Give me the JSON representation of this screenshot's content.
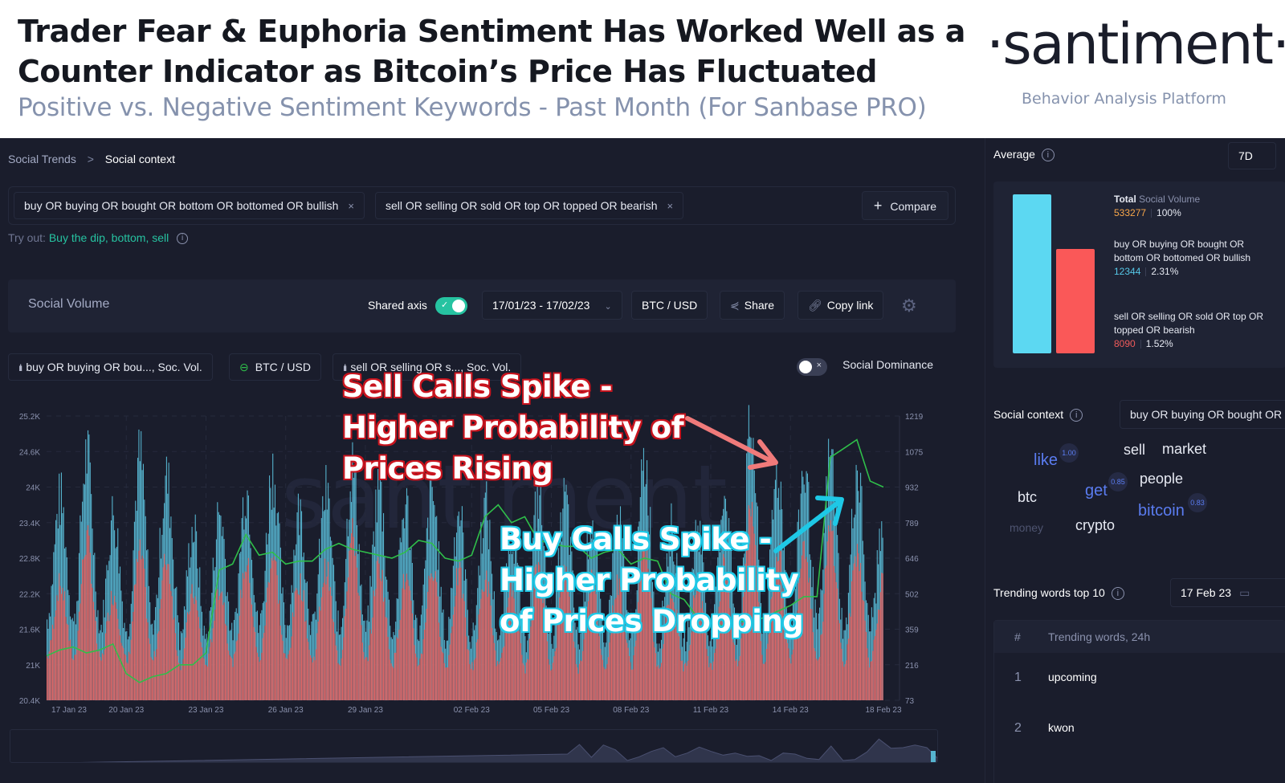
{
  "header": {
    "title_line1": "Trader Fear & Euphoria Sentiment Has Worked Well as a",
    "title_line2": "Counter Indicator as Bitcoin’s Price Has Fluctuated",
    "subtitle": "Positive vs. Negative Sentiment Keywords - Past Month (For Sanbase PRO)",
    "logo": "·santiment·",
    "tagline": "Behavior Analysis Platform"
  },
  "breadcrumb": {
    "parent": "Social Trends",
    "separator": ">",
    "current": "Social context"
  },
  "search": {
    "chips": [
      {
        "label": "buy OR buying OR bought OR bottom OR bottomed OR bullish",
        "remove": "×"
      },
      {
        "label": "sell OR selling OR sold OR top OR topped OR bearish",
        "remove": "×"
      }
    ],
    "compare_icon": "+",
    "compare_label": "Compare"
  },
  "tryout": {
    "prefix": "Try out:",
    "links": "Buy the dip, bottom, sell",
    "info": "i"
  },
  "toolbar": {
    "title": "Social Volume",
    "shared_axis_label": "Shared axis",
    "shared_axis_on": true,
    "date_range": "17/01/23 - 17/02/23",
    "pair": "BTC / USD",
    "share_label": "Share",
    "copy_link_label": "Copy link"
  },
  "legend": {
    "items": [
      {
        "label": "buy OR buying OR bou..., Soc. Vol.",
        "icon": "bars-icon"
      },
      {
        "label": "BTC / USD",
        "icon": "ring-icon"
      },
      {
        "label": "sell OR selling OR s..., Soc. Vol.",
        "icon": "bars-icon"
      }
    ],
    "social_dominance_label": "Social Dominance",
    "social_dominance_on": false
  },
  "annotations": {
    "sell_lines": [
      "Sell Calls Spike -",
      "Higher Probability of",
      "Prices Rising"
    ],
    "buy_lines": [
      "Buy Calls Spike -",
      "Higher Probability",
      "of Prices Dropping"
    ],
    "sell_color": "#f07a7a",
    "buy_color": "#1ec8e6"
  },
  "chart_data": {
    "type": "bar",
    "title": "Social Volume",
    "watermark": "santiment",
    "x_start": "17 Jan 23",
    "x_end": "18 Feb 23",
    "x_tick_labels": [
      "17 Jan 23",
      "20 Jan 23",
      "23 Jan 23",
      "26 Jan 23",
      "29 Jan 23",
      "02 Feb 23",
      "05 Feb 23",
      "08 Feb 23",
      "11 Feb 23",
      "14 Feb 23",
      "18 Feb 23"
    ],
    "left_axis": {
      "label": "BTC / USD",
      "ticks": [
        "20.4K",
        "21K",
        "21.6K",
        "22.2K",
        "22.8K",
        "23.4K",
        "24K",
        "24.6K",
        "25.2K"
      ],
      "range": [
        20400,
        25200
      ]
    },
    "right_axis": {
      "label": "Social Volume",
      "ticks": [
        "73",
        "216",
        "359",
        "502",
        "646",
        "789",
        "932",
        "1075",
        "1219"
      ],
      "range": [
        73,
        1219
      ]
    },
    "series": [
      {
        "name": "buy OR buying OR bought OR bottom OR bottomed OR bullish, Soc. Vol.",
        "type": "bar",
        "color": "#56b4cf",
        "axis": "right",
        "daily_peaks": [
          880,
          1060,
          820,
          1050,
          960,
          760,
          830,
          930,
          1000,
          830,
          900,
          1010,
          930,
          860,
          900,
          840,
          850,
          760,
          900,
          880,
          800,
          780,
          1030,
          760,
          780,
          920,
          1160,
          990,
          1000,
          1050,
          1000,
          780
        ],
        "daily_troughs": [
          400,
          380,
          360,
          330,
          390,
          310,
          330,
          350,
          380,
          360,
          370,
          340,
          360,
          330,
          350,
          300,
          330,
          320,
          300,
          320,
          300,
          330,
          320,
          300,
          310,
          320,
          330,
          360,
          380,
          360,
          330,
          400
        ]
      },
      {
        "name": "sell OR selling OR sold OR top OR topped OR bearish, Soc. Vol.",
        "type": "bar",
        "color": "#e06666",
        "axis": "right",
        "daily_peaks": [
          540,
          720,
          500,
          660,
          640,
          500,
          530,
          620,
          660,
          550,
          600,
          740,
          620,
          560,
          600,
          580,
          560,
          520,
          620,
          600,
          560,
          540,
          700,
          520,
          540,
          620,
          880,
          680,
          720,
          760,
          680,
          560
        ],
        "daily_troughs": [
          250,
          240,
          230,
          220,
          240,
          210,
          220,
          230,
          240,
          230,
          235,
          220,
          230,
          220,
          225,
          200,
          210,
          205,
          200,
          210,
          200,
          215,
          210,
          200,
          205,
          210,
          215,
          230,
          240,
          230,
          215,
          250
        ]
      },
      {
        "name": "BTC / USD",
        "type": "line",
        "color": "#2fbf4a",
        "axis": "left",
        "x_days": [
          0,
          0.5,
          1,
          1.5,
          2,
          2.5,
          3,
          3.5,
          4,
          4.5,
          5,
          5.5,
          6,
          6.5,
          7,
          7.5,
          8,
          8.5,
          9,
          9.5,
          10,
          10.5,
          11,
          11.5,
          12,
          12.5,
          13,
          13.5,
          14,
          14.5,
          15,
          15.5,
          16,
          16.5,
          17,
          17.5,
          18,
          18.5,
          19,
          19.5,
          20,
          20.5,
          21,
          21.5,
          22,
          22.5,
          23,
          23.5,
          24,
          24.5,
          25,
          25.5,
          26,
          26.5,
          27,
          27.5,
          28,
          28.5,
          29,
          29.5,
          30,
          30.5,
          31,
          31.5
        ],
        "values": [
          21150,
          21250,
          21300,
          21200,
          21250,
          21350,
          20850,
          20700,
          20800,
          20850,
          21000,
          21000,
          21200,
          22600,
          22700,
          23200,
          22850,
          22900,
          22700,
          22750,
          22750,
          22950,
          23050,
          22950,
          22900,
          22850,
          22800,
          22900,
          23100,
          23050,
          22800,
          22750,
          22850,
          23500,
          23700,
          23400,
          23500,
          23100,
          23050,
          23000,
          23000,
          22800,
          22900,
          22950,
          22700,
          22800,
          22750,
          22200,
          22100,
          21800,
          21700,
          21650,
          21750,
          21700,
          21800,
          21900,
          22000,
          22150,
          22150,
          24500,
          24650,
          24800,
          24100,
          24000
        ]
      }
    ],
    "legend_position": "top-left",
    "grid": true
  },
  "side": {
    "average": {
      "title": "Average",
      "period": "7D",
      "total_label_bold": "Total",
      "total_label_rest": "Social Volume",
      "total_value": "533277",
      "total_pct": "100%",
      "items": [
        {
          "label": "buy OR buying OR bought OR bottom OR bottomed OR bullish",
          "value": "12344",
          "pct": "2.31%",
          "color": "#5cd8f2",
          "share": 12344
        },
        {
          "label": "sell OR selling OR sold OR top OR topped OR bearish",
          "value": "8090",
          "pct": "1.52%",
          "color": "#fa5858",
          "share": 8090
        }
      ]
    },
    "social_context": {
      "title": "Social context",
      "selected": "buy OR buying OR bought OR bottom OR bottomed OR bullish",
      "words": [
        {
          "word": "like",
          "score": "1.00",
          "style": "hl"
        },
        {
          "word": "sell",
          "style": "normal"
        },
        {
          "word": "market",
          "style": "normal"
        },
        {
          "word": "get",
          "score": "0.85",
          "style": "hl"
        },
        {
          "word": "people",
          "style": "normal"
        },
        {
          "word": "btc",
          "style": "normal"
        },
        {
          "word": "bitcoin",
          "score": "0.83",
          "style": "hl"
        },
        {
          "word": "money",
          "style": "dim"
        },
        {
          "word": "crypto",
          "style": "normal"
        }
      ]
    },
    "trending": {
      "title": "Trending words top 10",
      "date": "17 Feb 23",
      "col_num": "#",
      "col_words": "Trending words, 24h",
      "rows": [
        {
          "rank": "1",
          "word": "upcoming"
        },
        {
          "rank": "2",
          "word": "kwon"
        }
      ]
    }
  }
}
